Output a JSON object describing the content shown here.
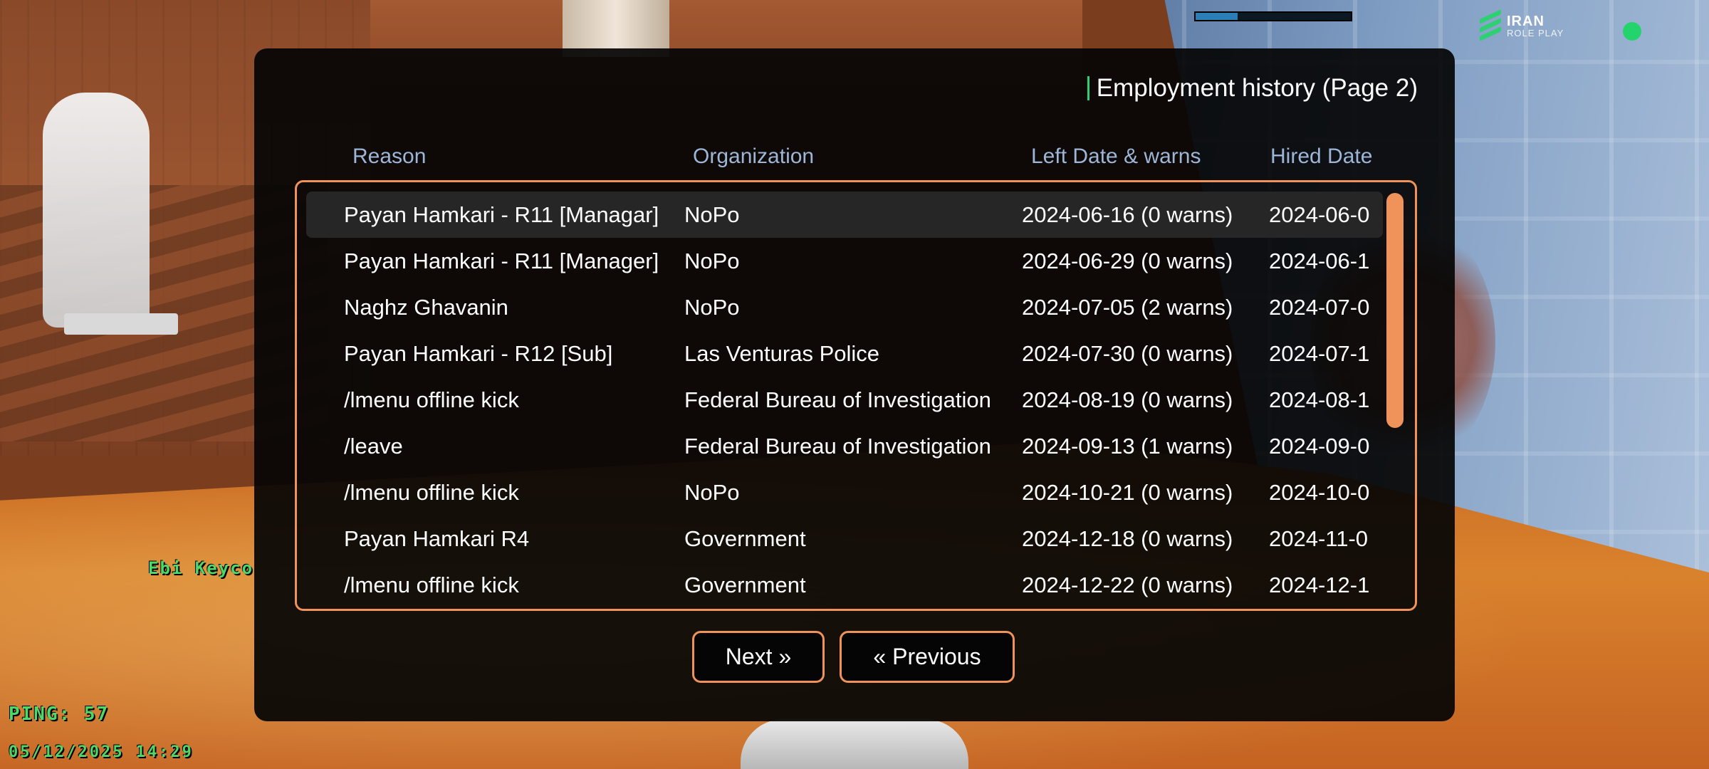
{
  "dialog": {
    "title": "Employment history (Page 2)",
    "columns": {
      "reason": "Reason",
      "organization": "Organization",
      "left": "Left Date & warns",
      "hired": "Hired Date"
    },
    "rows": [
      {
        "reason": "Payan Hamkari - R11 [Managar]",
        "organization": "NoPo",
        "left": "2024-06-16 (0 warns)",
        "hired": "2024-06-0"
      },
      {
        "reason": "Payan Hamkari - R11 [Manager]",
        "organization": "NoPo",
        "left": "2024-06-29 (0 warns)",
        "hired": "2024-06-1"
      },
      {
        "reason": "Naghz Ghavanin",
        "organization": "NoPo",
        "left": "2024-07-05 (2 warns)",
        "hired": "2024-07-0"
      },
      {
        "reason": "Payan Hamkari - R12 [Sub]",
        "organization": "Las Venturas Police",
        "left": "2024-07-30 (0 warns)",
        "hired": "2024-07-1"
      },
      {
        "reason": "/lmenu offline kick",
        "organization": "Federal Bureau of Investigation",
        "left": "2024-08-19 (0 warns)",
        "hired": "2024-08-1"
      },
      {
        "reason": "/leave",
        "organization": "Federal Bureau of Investigation",
        "left": "2024-09-13 (1 warns)",
        "hired": "2024-09-0"
      },
      {
        "reason": "/lmenu offline kick",
        "organization": "NoPo",
        "left": "2024-10-21 (0 warns)",
        "hired": "2024-10-0"
      },
      {
        "reason": "Payan Hamkari R4",
        "organization": "Government",
        "left": "2024-12-18 (0 warns)",
        "hired": "2024-11-0"
      },
      {
        "reason": "/lmenu offline kick",
        "organization": "Government",
        "left": "2024-12-22 (0 warns)",
        "hired": "2024-12-1"
      }
    ],
    "buttons": {
      "next": "Next »",
      "previous": "« Previous"
    },
    "accent_color": "#ef935a",
    "header_color": "#9db6d8"
  },
  "hud": {
    "logo_line1": "IRAN",
    "logo_line2": "ROLE PLAY",
    "player_tag": "Ebi Keyco",
    "ping": "PING: 57",
    "datetime": "05/12/2025 14:29",
    "progress": 0.27,
    "status_color": "#22d46b"
  }
}
